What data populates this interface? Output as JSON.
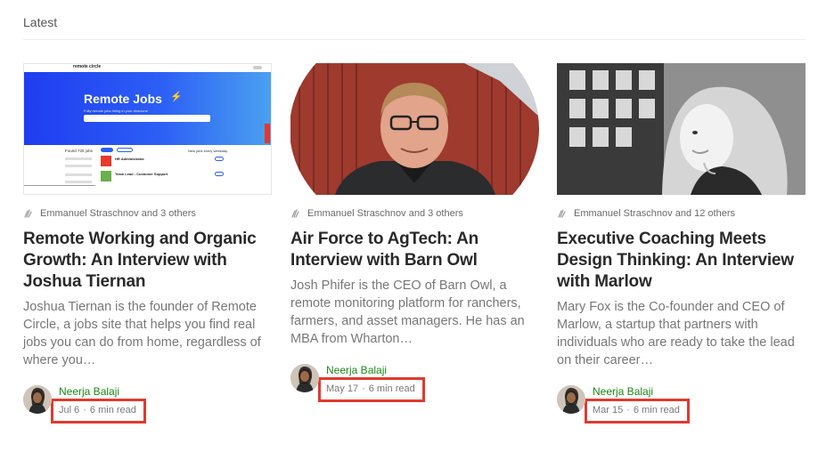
{
  "section": {
    "title": "Latest"
  },
  "cards": [
    {
      "image_alt": "Remote Circle jobs site screenshot",
      "thumb_site": {
        "logo": "remote circle",
        "hero_title": "Remote Jobs",
        "hero_sub": "Fully remote jobs hiring in your timezone",
        "found": "Found 725 jobs",
        "jobs": [
          "HR Administrator",
          "Team Lead - Customer Support"
        ],
        "new_jobs": "New jobs every weekday"
      },
      "recommenders": "Emmanuel Straschnov and 3 others",
      "title": "Remote Working and Organic Growth: An Interview with Joshua Tiernan",
      "excerpt": "Joshua Tiernan is the founder of Remote Circle, a jobs site that helps you find real jobs you can do from home, regardless of where you…",
      "author": "Neerja Balaji",
      "date": "Jul 6",
      "read_time": "6 min read",
      "dot": "·"
    },
    {
      "image_alt": "Portrait of Josh Phifer",
      "recommenders": "Emmanuel Straschnov and 3 others",
      "title": "Air Force to AgTech: An Interview with Barn Owl",
      "excerpt": "Josh Phifer is the CEO of Barn Owl, a remote monitoring platform for ranchers, farmers, and asset managers. He has an MBA from Wharton…",
      "author": "Neerja Balaji",
      "date": "May 17",
      "read_time": "6 min read",
      "dot": "·"
    },
    {
      "image_alt": "Black and white portrait of Mary Fox",
      "recommenders": "Emmanuel Straschnov and 12 others",
      "title": "Executive Coaching Meets Design Thinking: An Interview with Marlow",
      "excerpt": "Mary Fox is the Co-founder and CEO of Marlow, a startup that partners with individuals who are ready to take the lead on their career…",
      "author": "Neerja Balaji",
      "date": "Mar 15",
      "read_time": "6 min read",
      "dot": "·"
    }
  ],
  "colors": {
    "author": "#1a8917",
    "highlight": "#e03a2f"
  }
}
